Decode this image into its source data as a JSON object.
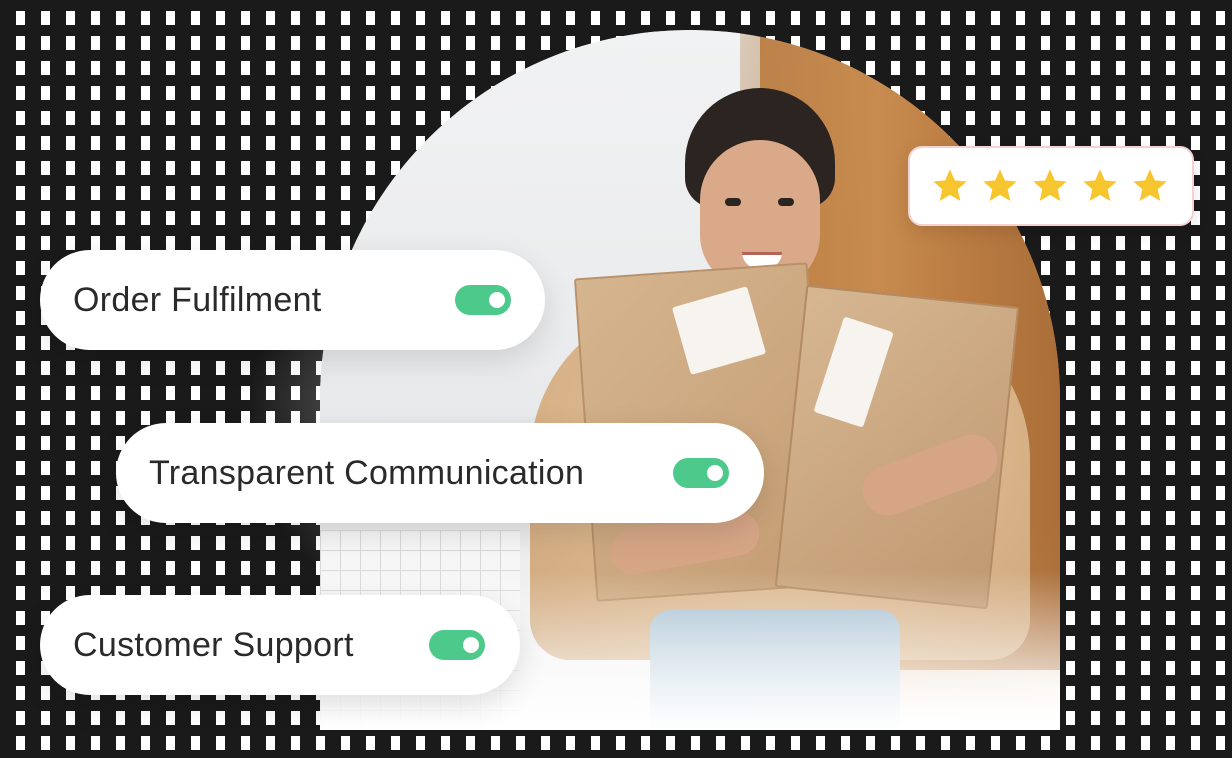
{
  "features": [
    {
      "label": "Order Fulfilment",
      "enabled": true
    },
    {
      "label": "Transparent Communication",
      "enabled": true
    },
    {
      "label": "Customer Support",
      "enabled": true
    }
  ],
  "rating": {
    "stars": 5,
    "max": 5
  },
  "colors": {
    "toggle_on": "#4cc98b",
    "star": "#f7c52e",
    "grid": "#1a1a1a"
  },
  "icons": [
    "toggle-switch-icon",
    "star-icon"
  ]
}
